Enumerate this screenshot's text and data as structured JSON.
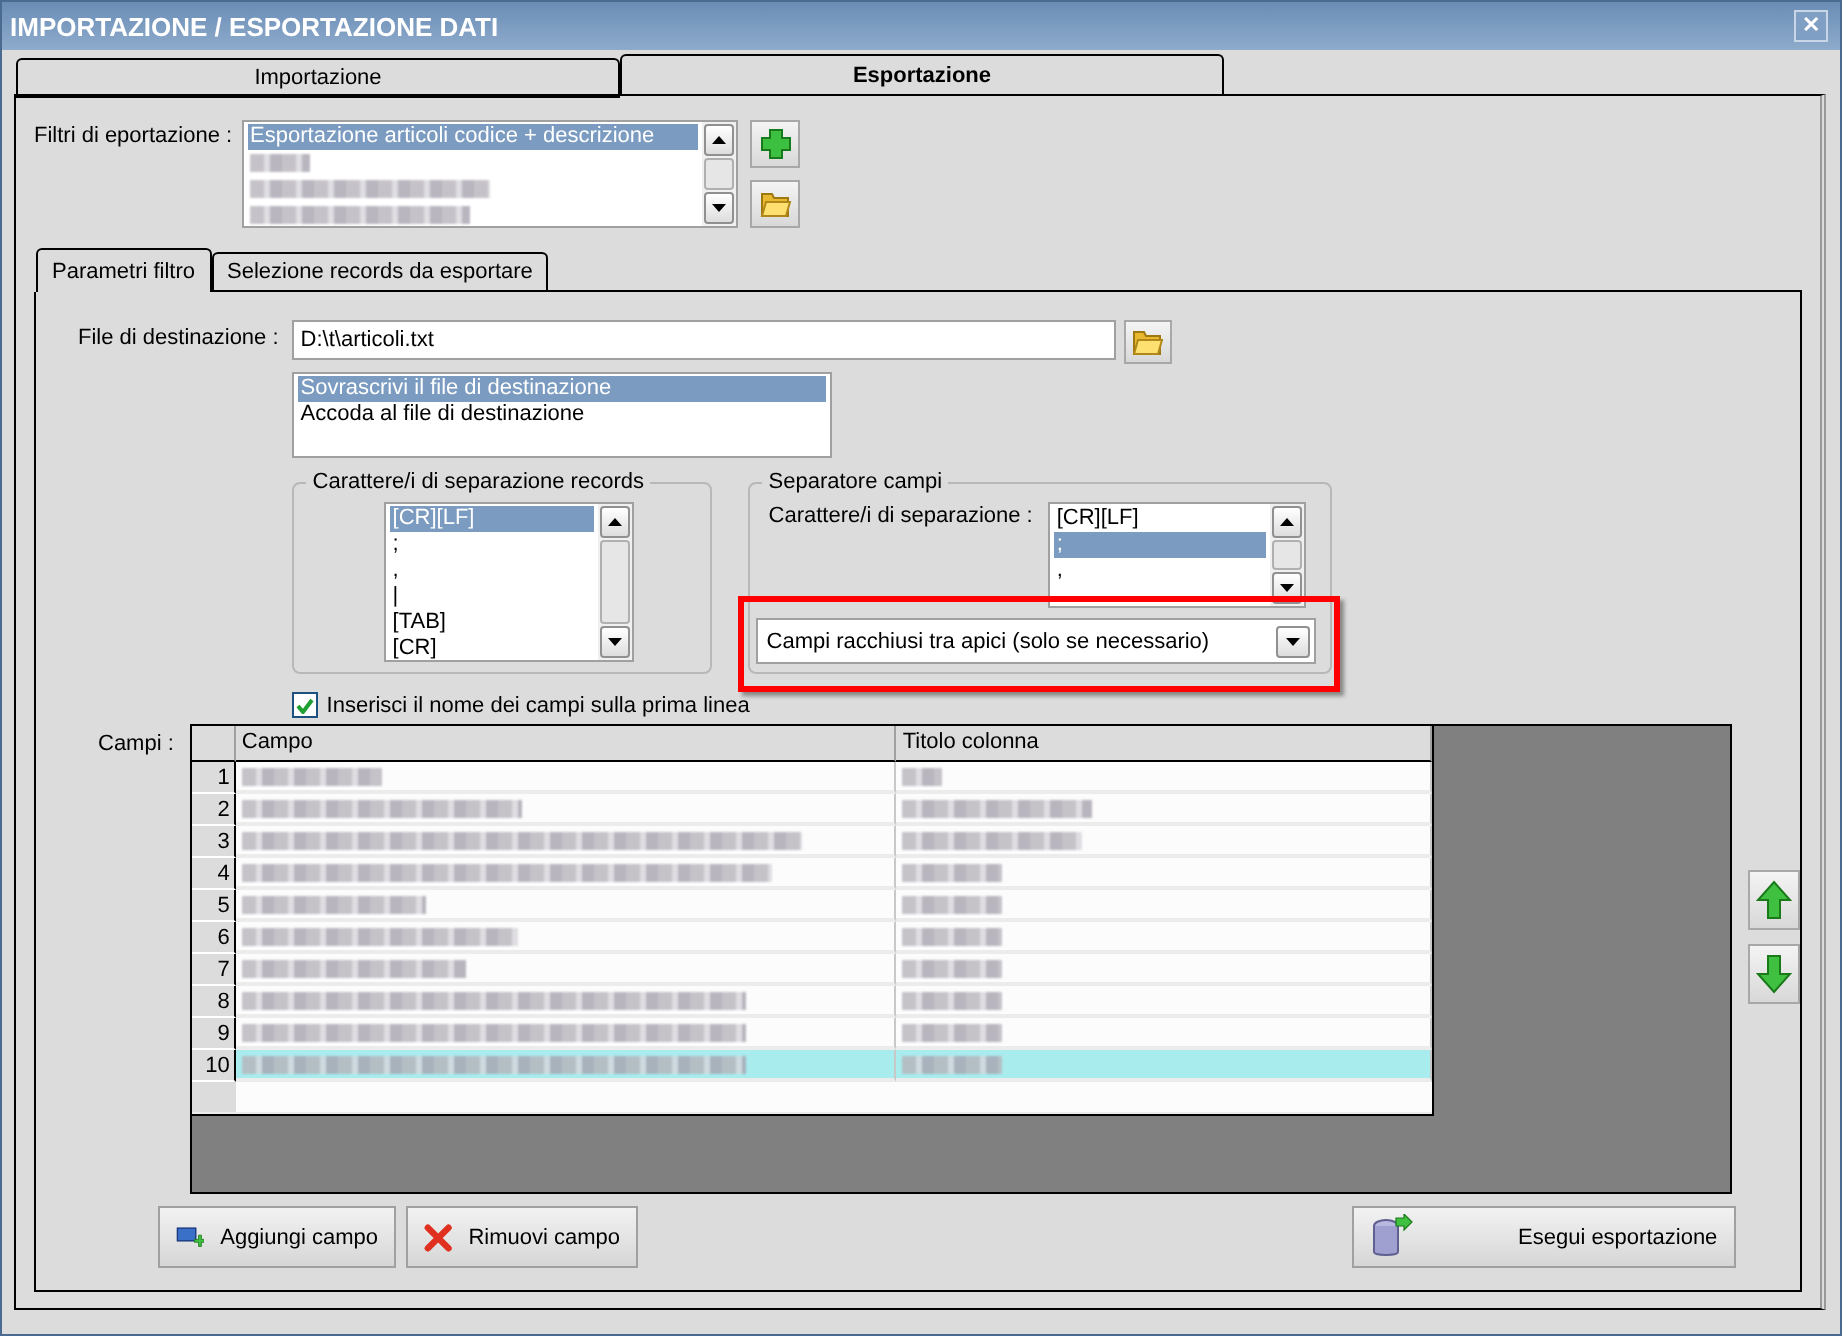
{
  "window": {
    "title": "IMPORTAZIONE / ESPORTAZIONE DATI",
    "close": "✕"
  },
  "tabs": [
    {
      "label": "Importazione",
      "selected": false
    },
    {
      "label": "Esportazione",
      "selected": true
    }
  ],
  "filters": {
    "label": "Filtri di eportazione :",
    "items": [
      {
        "kind": "text",
        "text": "Esportazione articoli codice + descrizione",
        "selected": true
      },
      {
        "kind": "redacted",
        "selected": false
      },
      {
        "kind": "redacted",
        "selected": false
      },
      {
        "kind": "redacted",
        "selected": false
      }
    ]
  },
  "subtabs": [
    {
      "label": "Parametri filtro",
      "selected": true
    },
    {
      "label": "Selezione records da esportare",
      "selected": false
    }
  ],
  "destination": {
    "label": "File di destinazione :",
    "value": "D:\\t\\articoli.txt",
    "modes": [
      {
        "text": "Sovrascrivi il file di destinazione",
        "selected": true
      },
      {
        "text": "Accoda al file di destinazione",
        "selected": false
      }
    ]
  },
  "record_separator": {
    "title": "Carattere/i di separazione records",
    "items": [
      {
        "text": "[CR][LF]",
        "selected": true
      },
      {
        "text": ";",
        "selected": false
      },
      {
        "text": ",",
        "selected": false
      },
      {
        "text": "|",
        "selected": false
      },
      {
        "text": "[TAB]",
        "selected": false
      },
      {
        "text": "[CR]",
        "selected": false
      }
    ]
  },
  "field_separator": {
    "title": "Separatore campi",
    "label": "Carattere/i di separazione :",
    "items": [
      {
        "text": "[CR][LF]",
        "selected": false
      },
      {
        "text": ";",
        "selected": true
      },
      {
        "text": ",",
        "selected": false
      }
    ],
    "quoting": {
      "value": "Campi racchiusi tra apici (solo se necessario)",
      "highlighted": true
    }
  },
  "header_checkbox": {
    "label": "Inserisci il nome dei campi sulla prima linea",
    "checked": true
  },
  "fields": {
    "label": "Campi :",
    "columns": [
      "Campo",
      "Titolo colonna"
    ],
    "rows": [
      {
        "number": "1",
        "selected": false
      },
      {
        "number": "2",
        "selected": false
      },
      {
        "number": "3",
        "selected": false
      },
      {
        "number": "4",
        "selected": false
      },
      {
        "number": "5",
        "selected": false
      },
      {
        "number": "6",
        "selected": false
      },
      {
        "number": "7",
        "selected": false
      },
      {
        "number": "8",
        "selected": false
      },
      {
        "number": "9",
        "selected": false
      },
      {
        "number": "10",
        "selected": true
      }
    ]
  },
  "buttons": {
    "add": "Aggiungi campo",
    "remove": "Rimuovi campo",
    "run": "Esegui esportazione"
  }
}
